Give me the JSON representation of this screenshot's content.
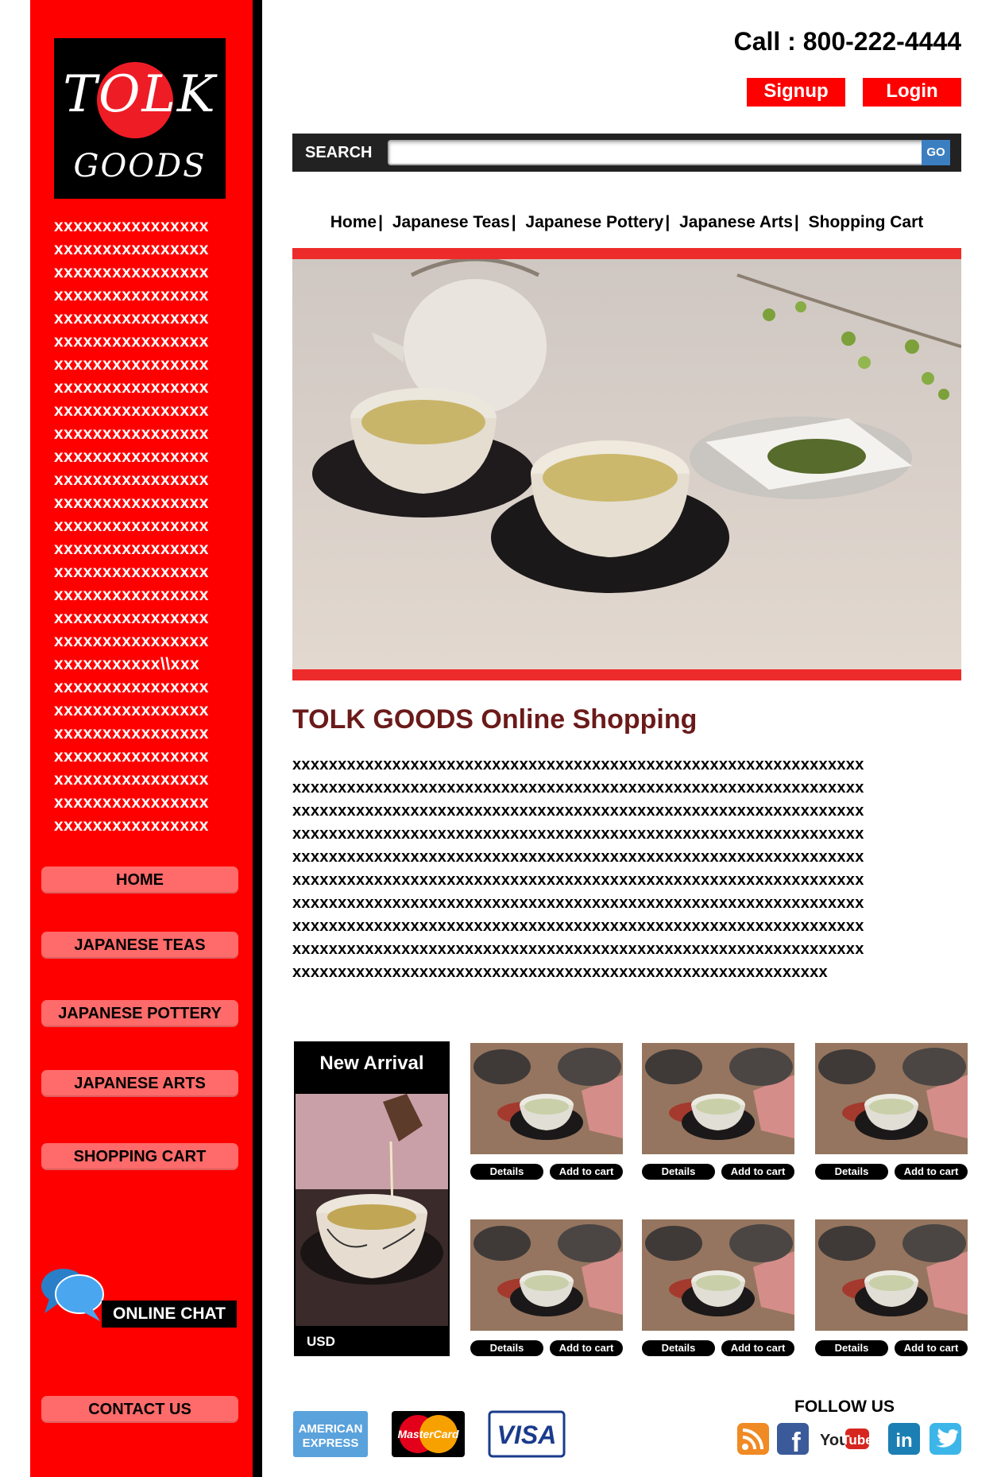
{
  "sidebar": {
    "logo_top": "TOLK",
    "logo_bottom": "GOODS",
    "text_lines": [
      "xxxxxxxxxxxxxxxx",
      "xxxxxxxxxxxxxxxx",
      "xxxxxxxxxxxxxxxx",
      "xxxxxxxxxxxxxxxx",
      "xxxxxxxxxxxxxxxx",
      "xxxxxxxxxxxxxxxx",
      "xxxxxxxxxxxxxxxx",
      "xxxxxxxxxxxxxxxx",
      "xxxxxxxxxxxxxxxx",
      "xxxxxxxxxxxxxxxx",
      "xxxxxxxxxxxxxxxx",
      "xxxxxxxxxxxxxxxx",
      "xxxxxxxxxxxxxxxx",
      "xxxxxxxxxxxxxxxx",
      "xxxxxxxxxxxxxxxx",
      "xxxxxxxxxxxxxxxx",
      "xxxxxxxxxxxxxxxx",
      "xxxxxxxxxxxxxxxx",
      "xxxxxxxxxxxxxxxx",
      "xxxxxxxxxxx\\\\xxx",
      "xxxxxxxxxxxxxxxx",
      "xxxxxxxxxxxxxxxx",
      "xxxxxxxxxxxxxxxx",
      "xxxxxxxxxxxxxxxx",
      "xxxxxxxxxxxxxxxx",
      "xxxxxxxxxxxxxxxx",
      "xxxxxxxxxxxxxxxx"
    ],
    "buttons": {
      "home": "HOME",
      "teas": "JAPANESE TEAS",
      "pottery": "JAPANESE POTTERY",
      "arts": "JAPANESE ARTS",
      "cart": "SHOPPING CART"
    },
    "online_chat": "ONLINE CHAT",
    "contact_us": "CONTACT US"
  },
  "header": {
    "call": "Call : 800-222-4444",
    "signup": "Signup",
    "login": "Login"
  },
  "search": {
    "label": "SEARCH",
    "value": "",
    "go": "GO"
  },
  "topnav": {
    "home": "Home",
    "teas": "Japanese Teas",
    "pottery": "Japanese Pottery",
    "arts": "Japanese Arts",
    "cart": "Shopping Cart",
    "separator": "|"
  },
  "main": {
    "title": "TOLK GOODS Online Shopping",
    "body_lines": [
      "xxxxxxxxxxxxxxxxxxxxxxxxxxxxxxxxxxxxxxxxxxxxxxxxxxxxxxxxxxxxxxx",
      "xxxxxxxxxxxxxxxxxxxxxxxxxxxxxxxxxxxxxxxxxxxxxxxxxxxxxxxxxxxxxxx",
      "xxxxxxxxxxxxxxxxxxxxxxxxxxxxxxxxxxxxxxxxxxxxxxxxxxxxxxxxxxxxxxx",
      "xxxxxxxxxxxxxxxxxxxxxxxxxxxxxxxxxxxxxxxxxxxxxxxxxxxxxxxxxxxxxxx",
      "xxxxxxxxxxxxxxxxxxxxxxxxxxxxxxxxxxxxxxxxxxxxxxxxxxxxxxxxxxxxxxx",
      "xxxxxxxxxxxxxxxxxxxxxxxxxxxxxxxxxxxxxxxxxxxxxxxxxxxxxxxxxxxxxxx",
      "xxxxxxxxxxxxxxxxxxxxxxxxxxxxxxxxxxxxxxxxxxxxxxxxxxxxxxxxxxxxxxx",
      "xxxxxxxxxxxxxxxxxxxxxxxxxxxxxxxxxxxxxxxxxxxxxxxxxxxxxxxxxxxxxxx",
      "xxxxxxxxxxxxxxxxxxxxxxxxxxxxxxxxxxxxxxxxxxxxxxxxxxxxxxxxxxxxxxx",
      "xxxxxxxxxxxxxxxxxxxxxxxxxxxxxxxxxxxxxxxxxxxxxxxxxxxxxxxxxxx"
    ]
  },
  "new_arrival": {
    "title": "New Arrival",
    "currency": "USD"
  },
  "products": [
    {
      "details": "Details",
      "add": "Add to cart"
    },
    {
      "details": "Details",
      "add": "Add to cart"
    },
    {
      "details": "Details",
      "add": "Add to cart"
    },
    {
      "details": "Details",
      "add": "Add to cart"
    },
    {
      "details": "Details",
      "add": "Add to cart"
    },
    {
      "details": "Details",
      "add": "Add to cart"
    }
  ],
  "payment": {
    "amex_1": "AMERICAN",
    "amex_2": "EXPRESS",
    "mastercard": "MasterCard",
    "visa": "VISA"
  },
  "follow": {
    "label": "FOLLOW US",
    "youtube_1": "You",
    "youtube_2": "Tube",
    "linkedin": "in",
    "facebook": "f"
  },
  "colors": {
    "brand_red": "#ff0000",
    "title_maroon": "#6b1a1a",
    "button_pink": "#ff6a6a",
    "go_blue": "#3c7fc1"
  },
  "icons": [
    "rss-icon",
    "facebook-icon",
    "youtube-icon",
    "linkedin-icon",
    "twitter-icon",
    "chat-bubbles-icon"
  ]
}
